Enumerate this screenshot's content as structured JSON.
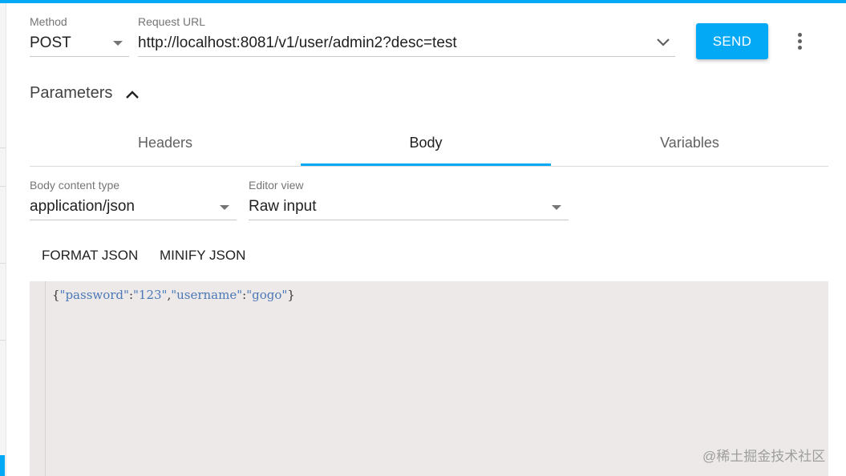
{
  "request": {
    "method_label": "Method",
    "method_value": "POST",
    "url_label": "Request URL",
    "url_value": "http://localhost:8081/v1/user/admin2?desc=test",
    "send_label": "SEND"
  },
  "parameters": {
    "title": "Parameters",
    "tabs": [
      {
        "label": "Headers",
        "active": false
      },
      {
        "label": "Body",
        "active": true
      },
      {
        "label": "Variables",
        "active": false
      }
    ]
  },
  "body": {
    "content_type_label": "Body content type",
    "content_type_value": "application/json",
    "editor_view_label": "Editor view",
    "editor_view_value": "Raw input",
    "format_label": "FORMAT JSON",
    "minify_label": "MINIFY JSON",
    "editor": {
      "open": "{",
      "key1": "\"password\"",
      "colon1": ":",
      "val1": "\"123\"",
      "comma": ",",
      "key2": "\"username\"",
      "colon2": ":",
      "val2": "\"gogo\"",
      "close": "}"
    }
  },
  "watermark": "@稀土掘金技术社区",
  "colors": {
    "accent": "#03a9f4",
    "editor_bg": "#ede9e8",
    "json_string": "#4a78b8"
  },
  "icons": {
    "method_dropdown": "caret-down-icon",
    "url_history": "chevron-down-icon",
    "more": "more-vert-icon",
    "collapse": "chevron-up-icon"
  }
}
